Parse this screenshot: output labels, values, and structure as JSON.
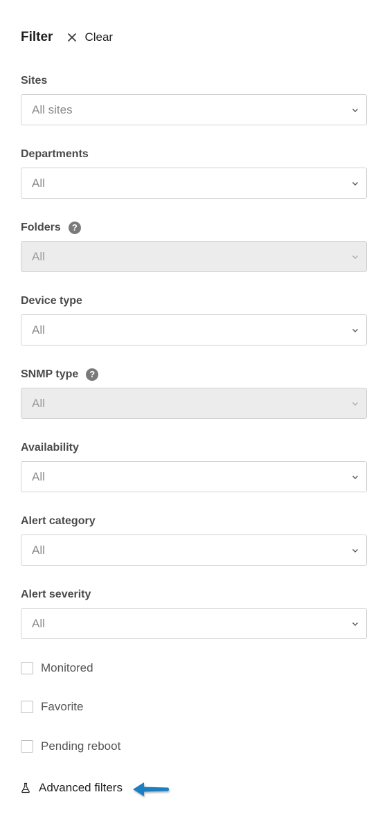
{
  "header": {
    "title": "Filter",
    "clear_label": "Clear"
  },
  "fields": [
    {
      "label": "Sites",
      "value": "All sites",
      "help": false,
      "disabled": false
    },
    {
      "label": "Departments",
      "value": "All",
      "help": false,
      "disabled": false
    },
    {
      "label": "Folders",
      "value": "All",
      "help": true,
      "disabled": true
    },
    {
      "label": "Device type",
      "value": "All",
      "help": false,
      "disabled": false
    },
    {
      "label": "SNMP type",
      "value": "All",
      "help": true,
      "disabled": true
    },
    {
      "label": "Availability",
      "value": "All",
      "help": false,
      "disabled": false
    },
    {
      "label": "Alert category",
      "value": "All",
      "help": false,
      "disabled": false
    },
    {
      "label": "Alert severity",
      "value": "All",
      "help": false,
      "disabled": false
    }
  ],
  "help_glyph": "?",
  "checkboxes": [
    {
      "label": "Monitored",
      "checked": false
    },
    {
      "label": "Favorite",
      "checked": false
    },
    {
      "label": "Pending reboot",
      "checked": false
    }
  ],
  "advanced": {
    "label": "Advanced filters",
    "icon": "flask-icon"
  },
  "colors": {
    "annotation_arrow": "#1a7fc4",
    "disabled_bg": "#ececec",
    "help_bg": "#7a7a7a"
  }
}
